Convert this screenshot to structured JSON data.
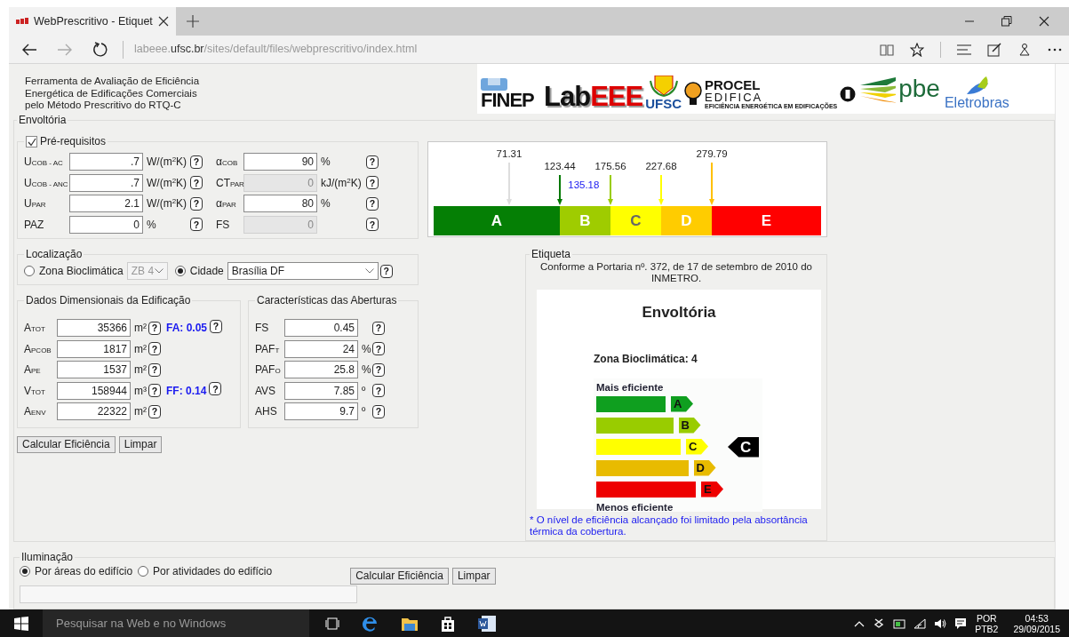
{
  "browser": {
    "tab": {
      "title": "WebPrescritivo - Etiquet",
      "selected": true
    },
    "address": {
      "prefix": "labeee.",
      "domain": "ufsc.br",
      "path": "/sites/default/files/webprescritivo/index.html"
    }
  },
  "header": {
    "title_lines": [
      "Ferramenta de Avaliação de Eficiência",
      "Energética de Edificações Comerciais",
      "pelo Método Prescritivo do RTQ-C"
    ]
  },
  "logos": [
    {
      "kind": "finep",
      "text": "FINEP"
    },
    {
      "kind": "labeee",
      "text": "Lab",
      "accent": "EEE"
    },
    {
      "kind": "ufsc",
      "text": "UFSC"
    },
    {
      "kind": "procel",
      "text": "PROCEL",
      "line2": "EDIFICA",
      "tagline": "EFICIÊNCIA ENERGÉTICA EM EDIFICAÇÕES"
    },
    {
      "kind": "pbe",
      "text": "pbe"
    },
    {
      "kind": "eletrobras",
      "text": "Eletrobras"
    }
  ],
  "envelope": {
    "title": "Envoltória",
    "prerequisites": {
      "label": "Pré-requisitos",
      "checked": true,
      "rows": [
        {
          "left": {
            "label": "U$_{COB - AC}$",
            "value": ".7",
            "unit": "W/(m$^{2}$K)",
            "help": "?",
            "disabled": false
          },
          "right": {
            "label": "α$_{COB}$",
            "value": "90",
            "unit": "%",
            "help": "?",
            "disabled": false
          }
        },
        {
          "left": {
            "label": "U$_{COB - ANC}$",
            "value": ".7",
            "unit": "W/(m$^{2}$K)",
            "help": "?",
            "disabled": false
          },
          "right": {
            "label": "CT$_{PAR}$",
            "value": "0",
            "unit": "kJ/(m$^{2}$K)",
            "help": "?",
            "disabled": true
          }
        },
        {
          "left": {
            "label": "U$_{PAR}$",
            "value": "2.1",
            "unit": "W/(m$^{2}$K)",
            "help": "?",
            "disabled": false
          },
          "right": {
            "label": "α$_{PAR}$",
            "value": "80",
            "unit": "%",
            "help": "?",
            "disabled": false
          }
        },
        {
          "left": {
            "label": "PAZ",
            "value": "0",
            "unit": "%",
            "help": "?",
            "disabled": false
          },
          "right": {
            "label": "FS",
            "value": "0",
            "help": "?",
            "disabled": true
          }
        }
      ]
    },
    "location": {
      "title": "Localização",
      "options": [
        {
          "label": "Zona Bioclimática",
          "selected": false,
          "select": "ZB 4",
          "disabled": true
        },
        {
          "label": "Cidade",
          "selected": true,
          "select": "Brasília DF",
          "disabled": false,
          "help": "?"
        }
      ]
    },
    "dimensions": {
      "title": "Dados Dimensionais da Edificação",
      "rows": [
        {
          "label": "A$_{TOT}$",
          "value": "35366",
          "unit": "m²",
          "help": "?",
          "extra": "FA: 0.05",
          "extra_help": "?"
        },
        {
          "label": "A$_{PCOB}$",
          "value": "1817",
          "unit": "m²",
          "help": "?"
        },
        {
          "label": "A$_{PE}$",
          "value": "1537",
          "unit": "m²",
          "help": "?"
        },
        {
          "label": "V$_{TOT}$",
          "value": "158944",
          "unit": "m³",
          "help": "?",
          "extra": "FF: 0.14",
          "extra_help": "?"
        },
        {
          "label": "A$_{ENV}$",
          "value": "22322",
          "unit": "m²",
          "help": "?"
        }
      ]
    },
    "openings": {
      "title": "Características das Aberturas",
      "rows": [
        {
          "label": "FS",
          "value": "0.45",
          "help": "?"
        },
        {
          "label": "PAF$_{T}$",
          "value": "24",
          "unit": "%",
          "help": "?"
        },
        {
          "label": "PAF$_{O}$",
          "value": "25.8",
          "unit": "%",
          "help": "?"
        },
        {
          "label": "AVS",
          "value": "7.85",
          "unit": "º",
          "help": "?"
        },
        {
          "label": "AHS",
          "value": "9.7",
          "unit": "º",
          "help": "?"
        }
      ]
    },
    "buttons": [
      "Calcular Eficiência",
      "Limpar"
    ],
    "scale": {
      "segments": [
        {
          "label": "A",
          "color": "#057f05"
        },
        {
          "label": "B",
          "color": "#9fcc00"
        },
        {
          "label": "C",
          "color": "#ffff00"
        },
        {
          "label": "D",
          "color": "#ffcc00"
        },
        {
          "label": "E",
          "color": "#ff0000"
        }
      ],
      "markers": [
        {
          "value": "71.31",
          "color": "#dddddd",
          "high": true
        },
        {
          "value": "123.44",
          "color": "#007800",
          "high": false
        },
        {
          "value": "175.56",
          "color": "#99cc00",
          "high": false
        },
        {
          "value": "227.68",
          "color": "#ffff00",
          "high": false
        },
        {
          "value": "279.79",
          "color": "#ffc000",
          "high": true
        }
      ],
      "result": "135.18"
    },
    "label": {
      "title": "Etiqueta",
      "note": "Conforme a Portaria nº. 372, de 17 de setembro de 2010 do INMETRO.",
      "heading": "Envoltória",
      "zone": "Zona Bioclimática: 4",
      "top": "Mais eficiente",
      "bottom": "Menos eficiente",
      "rating_tag": "C",
      "rows": [
        {
          "label": "A",
          "color": "#0f9f1f",
          "selected": false
        },
        {
          "label": "B",
          "color": "#99cc00",
          "selected": false
        },
        {
          "label": "C",
          "color": "#ffff00",
          "selected": true
        },
        {
          "label": "D",
          "color": "#e8bb00",
          "selected": false
        },
        {
          "label": "E",
          "color": "#ee0000",
          "selected": false
        }
      ],
      "footnote": "* O nível de eficiência alcançado foi limitado pela absortância térmica da cobertura."
    }
  },
  "lighting": {
    "title": "Iluminação",
    "options": [
      {
        "label": "Por áreas do edifício",
        "selected": true
      },
      {
        "label": "Por atividades do edifício",
        "selected": false
      }
    ],
    "buttons": [
      "Calcular Eficiência",
      "Limpar"
    ]
  },
  "taskbar": {
    "search_placeholder": "Pesquisar na Web e no Windows",
    "language": "POR",
    "layout": "PTB2",
    "time": "04:53",
    "date": "29/09/2015"
  }
}
